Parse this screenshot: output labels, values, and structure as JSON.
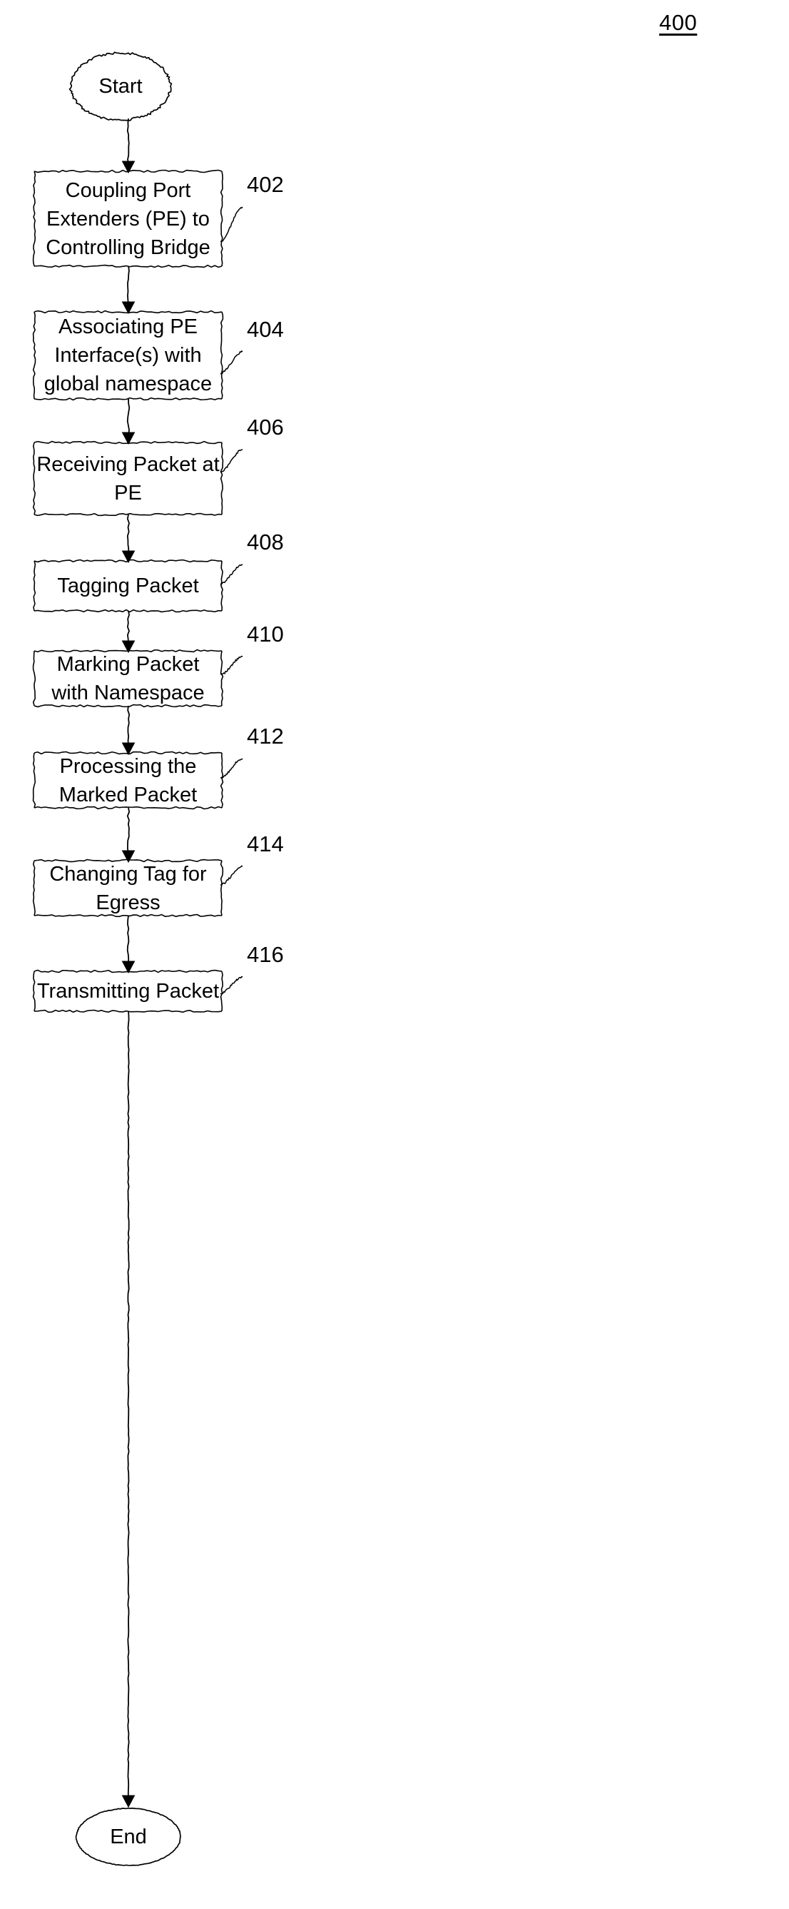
{
  "figure": {
    "number": "400"
  },
  "flowchart": {
    "start_label": "Start",
    "end_label": "End",
    "steps": [
      {
        "ref": "402",
        "text": "Coupling Port\nExtenders (PE) to\nControlling Bridge"
      },
      {
        "ref": "404",
        "text": "Associating PE\nInterface(s) with\nglobal namespace"
      },
      {
        "ref": "406",
        "text": "Receiving Packet at\nPE"
      },
      {
        "ref": "408",
        "text": "Tagging Packet"
      },
      {
        "ref": "410",
        "text": "Marking Packet\nwith Namespace"
      },
      {
        "ref": "412",
        "text": "Processing the\nMarked Packet"
      },
      {
        "ref": "414",
        "text": "Changing Tag for\nEgress"
      },
      {
        "ref": "416",
        "text": "Transmitting Packet"
      }
    ]
  },
  "style": {
    "stroke_color": "#000000",
    "background_color": "#ffffff"
  }
}
